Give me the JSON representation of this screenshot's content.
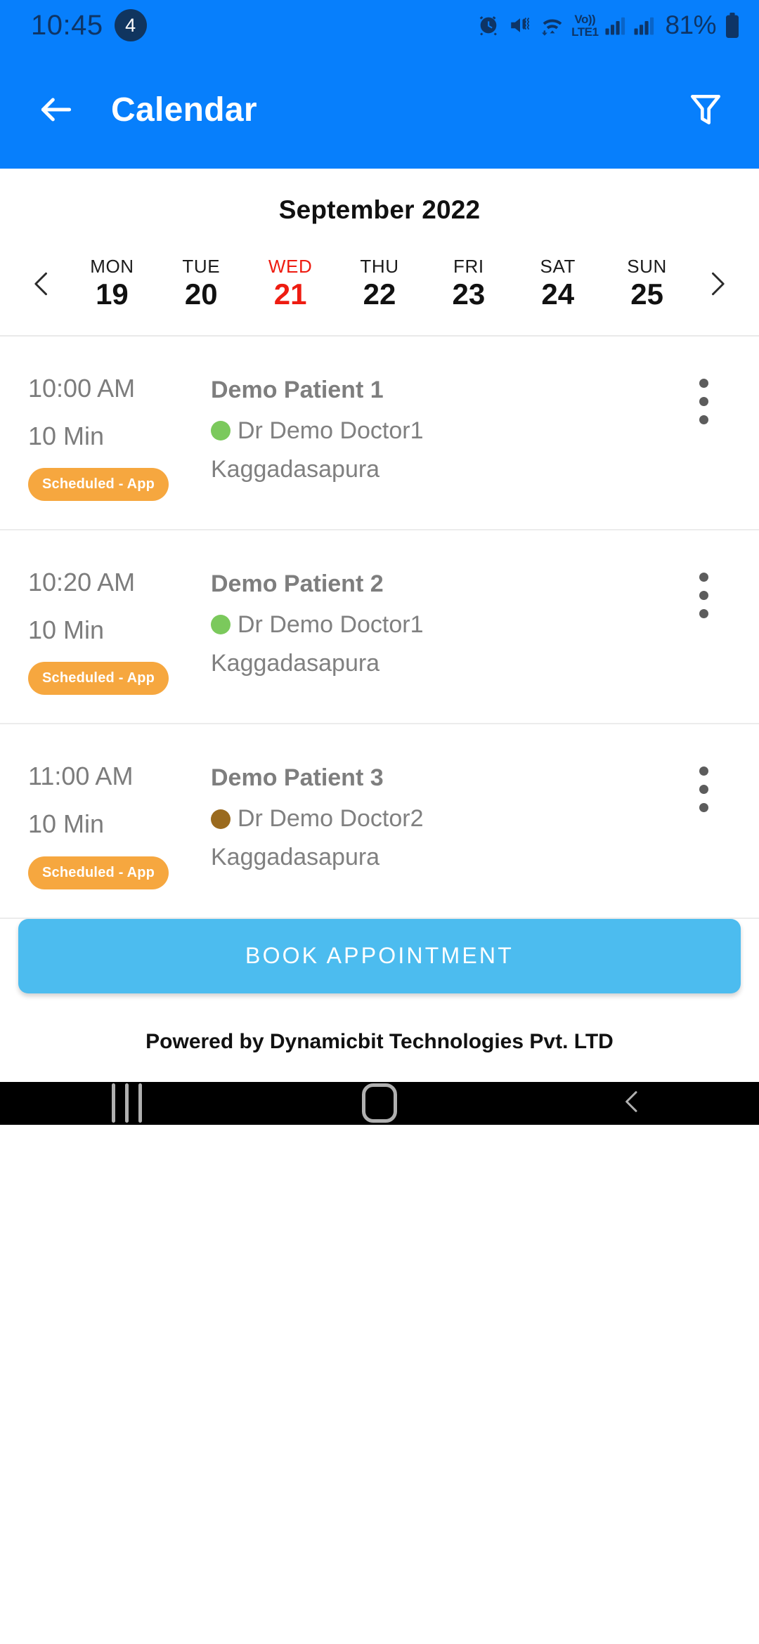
{
  "status_bar": {
    "time": "10:45",
    "notification_count": "4",
    "volte_line1": "Vo))",
    "volte_line2": "LTE1",
    "battery": "81%",
    "icons": [
      "alarm-icon",
      "mute-vibrate-icon",
      "wifi-icon",
      "volte-indicator",
      "signal-bars-1-icon",
      "signal-bars-2-icon",
      "battery-icon"
    ]
  },
  "app_bar": {
    "back_label": "back-arrow",
    "title": "Calendar",
    "filter_label": "filter-funnel"
  },
  "calendar": {
    "month": "September 2022",
    "prev_label": "previous-week",
    "next_label": "next-week",
    "days": [
      {
        "dow": "MON",
        "num": "19",
        "today": false
      },
      {
        "dow": "TUE",
        "num": "20",
        "today": false
      },
      {
        "dow": "WED",
        "num": "21",
        "today": true
      },
      {
        "dow": "THU",
        "num": "22",
        "today": false
      },
      {
        "dow": "FRI",
        "num": "23",
        "today": false
      },
      {
        "dow": "SAT",
        "num": "24",
        "today": false
      },
      {
        "dow": "SUN",
        "num": "25",
        "today": false
      }
    ]
  },
  "appointments": [
    {
      "time": "10:00 AM",
      "duration": "10 Min",
      "status": "Scheduled - App",
      "patient": "Demo Patient 1",
      "doctor": "Dr Demo Doctor1",
      "doctor_color": "#7BC95C",
      "location": "Kaggadasapura"
    },
    {
      "time": "10:20 AM",
      "duration": "10 Min",
      "status": "Scheduled - App",
      "patient": "Demo Patient 2",
      "doctor": "Dr Demo Doctor1",
      "doctor_color": "#7BC95C",
      "location": "Kaggadasapura"
    },
    {
      "time": "11:00 AM",
      "duration": "10 Min",
      "status": "Scheduled - App",
      "patient": "Demo Patient 3",
      "doctor": "Dr Demo Doctor2",
      "doctor_color": "#9A6A1E",
      "location": "Kaggadasapura"
    }
  ],
  "footer": {
    "book_button": "BOOK APPOINTMENT",
    "powered_by": "Powered by Dynamicbit Technologies Pvt. LTD"
  },
  "nav_bar": {
    "recents_label": "recents",
    "home_label": "home",
    "back_label": "back"
  },
  "colors": {
    "header_blue": "#077FFC",
    "badge_orange": "#F6A73F",
    "button_blue": "#4CBCEF",
    "today_red": "#EE1C11"
  }
}
